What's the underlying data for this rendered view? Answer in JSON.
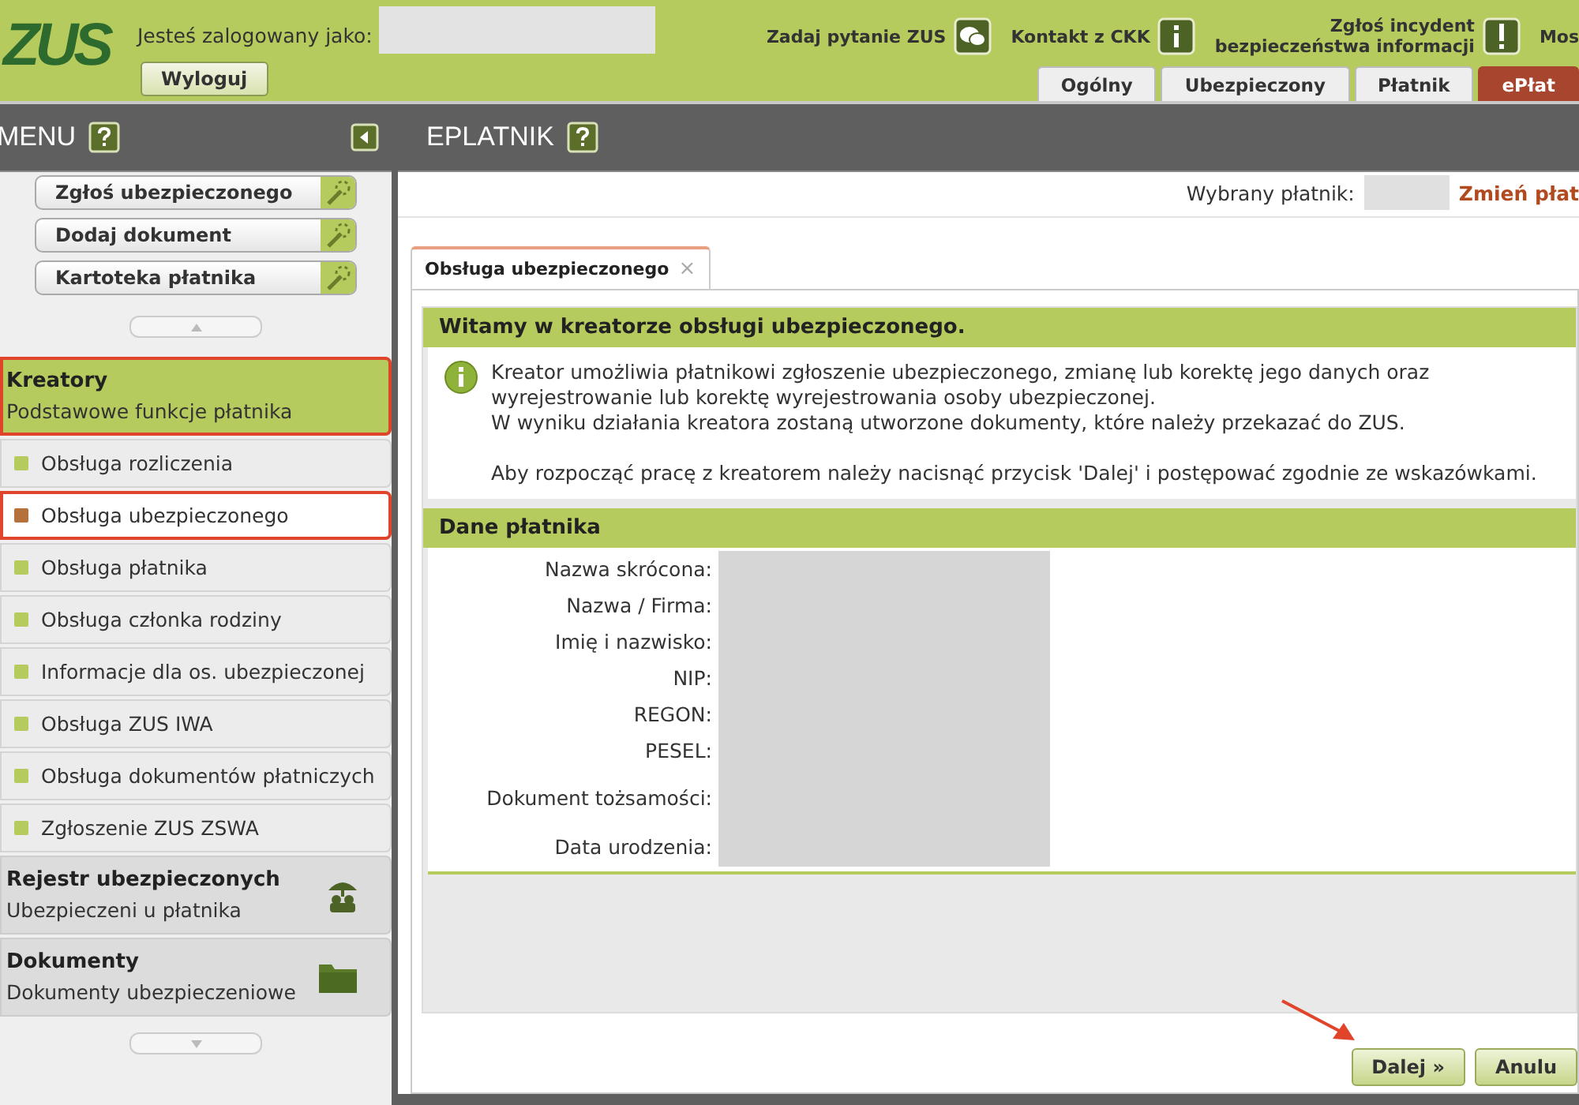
{
  "header": {
    "logo": "ZUS",
    "login_label": "Jesteś zalogowany jako:",
    "logout_button": "Wyloguj",
    "links": [
      {
        "label": "Zadaj pytanie ZUS",
        "kind": "chat"
      },
      {
        "label": "Kontakt z CKK",
        "kind": "info"
      },
      {
        "label": "Zgłoś incydent\nbezpieczeństwa informacji",
        "kind": "alert"
      },
      {
        "label": "Mos",
        "kind": "none"
      }
    ],
    "tabs": [
      {
        "label": "Ogólny",
        "selected": false
      },
      {
        "label": "Ubezpieczony",
        "selected": false
      },
      {
        "label": "Płatnik",
        "selected": false
      },
      {
        "label": "ePłat",
        "selected": true
      }
    ]
  },
  "sidebar": {
    "title": "MENU",
    "quick_buttons": [
      "Zgłoś ubezpieczonego",
      "Dodaj dokument",
      "Kartoteka płatnika"
    ],
    "sections": [
      {
        "title": "Kreatory",
        "subtitle": "Podstawowe funkcje płatnika",
        "expanded": true,
        "highlighted": true,
        "items": [
          {
            "label": "Obsługa rozliczenia",
            "selected": false,
            "highlighted": false
          },
          {
            "label": "Obsługa ubezpieczonego",
            "selected": true,
            "highlighted": true
          },
          {
            "label": "Obsługa płatnika",
            "selected": false,
            "highlighted": false
          },
          {
            "label": "Obsługa członka rodziny",
            "selected": false,
            "highlighted": false
          },
          {
            "label": "Informacje dla os. ubezpieczonej",
            "selected": false,
            "highlighted": false
          },
          {
            "label": "Obsługa ZUS IWA",
            "selected": false,
            "highlighted": false
          },
          {
            "label": "Obsługa dokumentów płatniczych",
            "selected": false,
            "highlighted": false
          },
          {
            "label": "Zgłoszenie ZUS ZSWA",
            "selected": false,
            "highlighted": false
          }
        ]
      },
      {
        "title": "Rejestr ubezpieczonych",
        "subtitle": "Ubezpieczeni u płatnika",
        "expanded": false,
        "highlighted": false
      },
      {
        "title": "Dokumenty",
        "subtitle": "Dokumenty ubezpieczeniowe",
        "expanded": false,
        "highlighted": false
      }
    ]
  },
  "main": {
    "title": "EPLATNIK",
    "payer_label": "Wybrany płatnik:",
    "change_payer_link": "Zmień płat",
    "doc_tab": {
      "label": "Obsługa ubezpieczonego",
      "close": "×"
    },
    "welcome_title": "Witamy w kreatorze obsługi ubezpieczonego.",
    "info_paragraphs": [
      "Kreator umożliwia płatnikowi zgłoszenie ubezpieczonego, zmianę lub korektę jego danych oraz wyrejestrowanie lub korektę wyrejestrowania osoby ubezpieczonej.",
      "W wyniku działania kreatora zostaną utworzone dokumenty, które należy przekazać do ZUS.",
      "Aby rozpocząć pracę z kreatorem należy nacisnąć przycisk 'Dalej' i postępować zgodnie ze wskazówkami."
    ],
    "payer_section_title": "Dane płatnika",
    "payer_fields": [
      "Nazwa skrócona:",
      "Nazwa / Firma:",
      "Imię i nazwisko:",
      "NIP:",
      "REGON:",
      "PESEL:",
      "Dokument tożsamości:",
      "Data urodzenia:"
    ],
    "annotation_arrow": true,
    "buttons": [
      {
        "label": "Dalej »"
      },
      {
        "label": "Anulu"
      }
    ]
  }
}
